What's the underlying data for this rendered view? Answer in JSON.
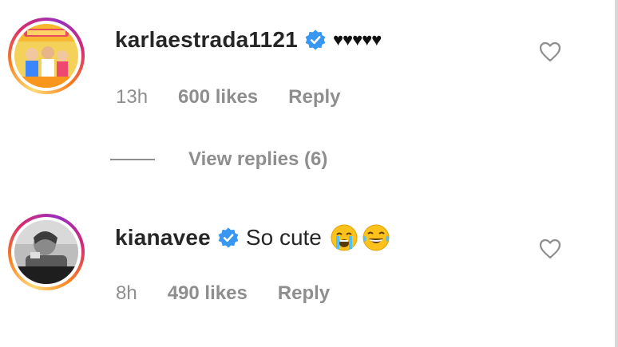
{
  "comments": [
    {
      "username": "karlaestrada1121",
      "text": "♥♥♥♥♥",
      "time": "13h",
      "likes": "600 likes",
      "reply": "Reply",
      "view_replies": "View replies (6)",
      "avatar_icon": "poster-thumbnail"
    },
    {
      "username": "kianavee",
      "text": "So cute",
      "time": "8h",
      "likes": "490 likes",
      "reply": "Reply",
      "emojis": [
        "crying-face-icon",
        "tears-of-joy-icon"
      ],
      "avatar_icon": "bw-photo-thumbnail"
    }
  ],
  "colors": {
    "verified": "#3897f0",
    "muted": "#8e8e8e",
    "text": "#262626"
  }
}
